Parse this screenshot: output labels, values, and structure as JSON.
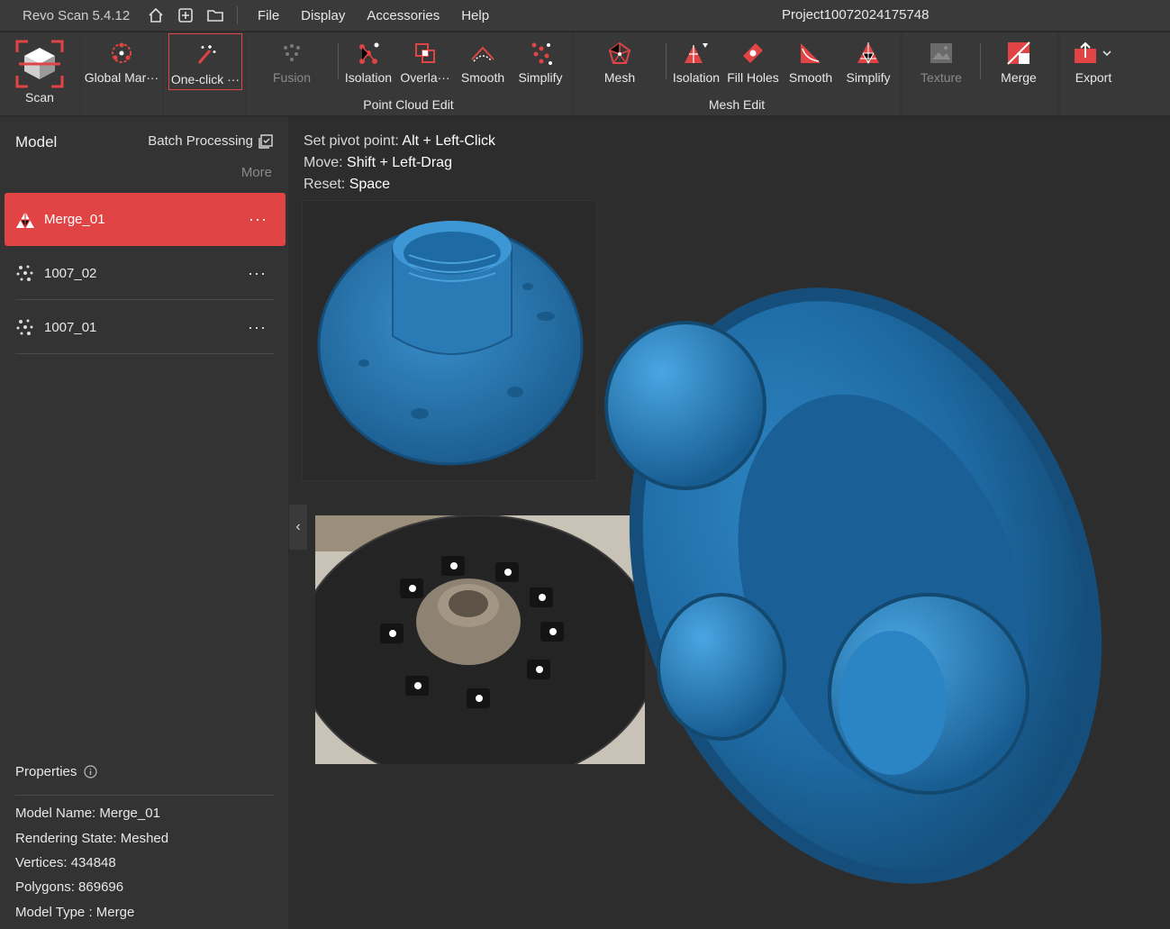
{
  "app": {
    "title": "Revo Scan 5.4.12",
    "project_title": "Project10072024175748",
    "menu": [
      "File",
      "Display",
      "Accessories",
      "Help"
    ]
  },
  "toolbar": {
    "scan": "Scan",
    "global_markers": "Global Mar···",
    "one_click": "One-click ···",
    "fusion": "Fusion",
    "pc_isolation": "Isolation",
    "pc_overlap": "Overla···",
    "pc_smooth": "Smooth",
    "pc_simplify": "Simplify",
    "point_cloud_group": "Point Cloud Edit",
    "mesh": "Mesh",
    "mesh_isolation": "Isolation",
    "fill_holes": "Fill Holes",
    "mesh_smooth": "Smooth",
    "mesh_simplify": "Simplify",
    "mesh_group": "Mesh Edit",
    "texture": "Texture",
    "merge": "Merge",
    "export": "Export"
  },
  "sidebar": {
    "title": "Model",
    "batch": "Batch Processing",
    "more": "More",
    "models": [
      {
        "name": "Merge_01",
        "dots": "···"
      },
      {
        "name": "1007_02",
        "dots": "···"
      },
      {
        "name": "1007_01",
        "dots": "···"
      }
    ],
    "properties_title": "Properties",
    "properties": [
      "Model Name:  Merge_01",
      "Rendering State:  Meshed",
      "Vertices:  434848",
      "Polygons:  869696",
      "Model Type :  Merge"
    ]
  },
  "viewport": {
    "hint1_label": "Set pivot point: ",
    "hint1_key": "Alt + Left-Click",
    "hint2_label": "Move: ",
    "hint2_key": "Shift + Left-Drag",
    "hint3_label": "Reset: ",
    "hint3_key": "Space",
    "collapse": "‹"
  },
  "colors": {
    "accent": "#e04444",
    "mesh_blue": "#1f6ea8"
  }
}
